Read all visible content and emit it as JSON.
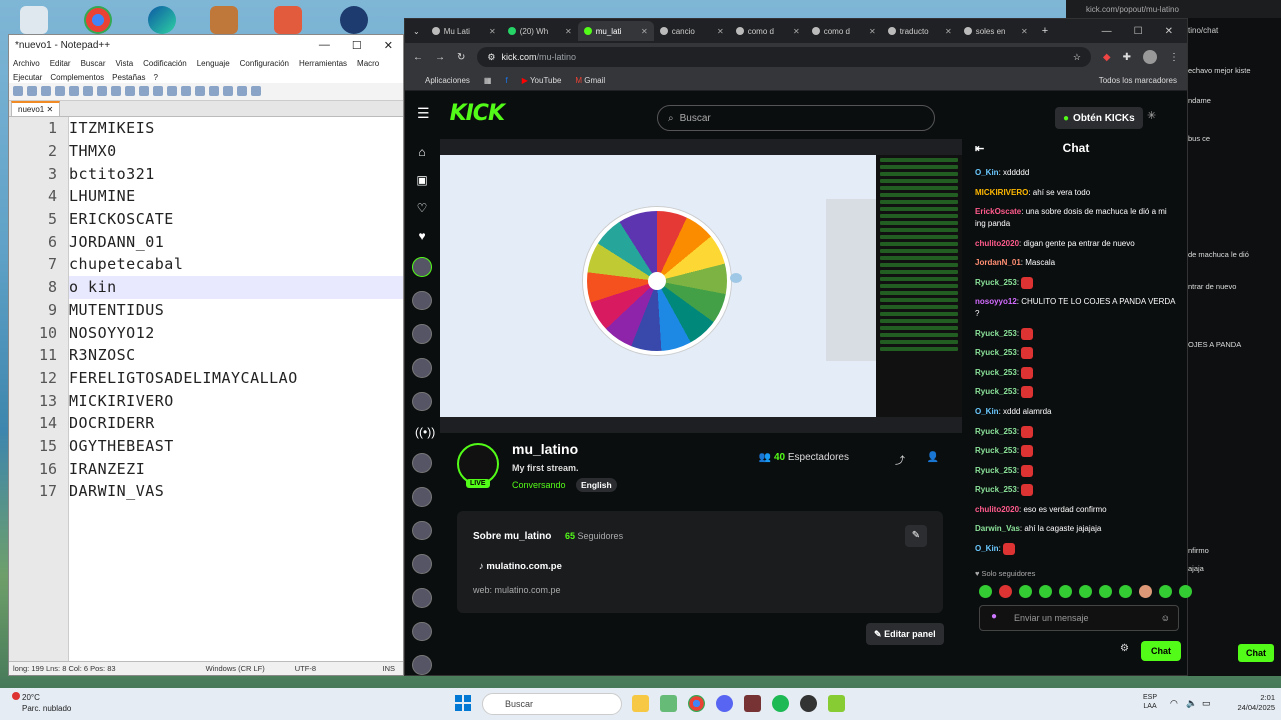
{
  "notepad": {
    "title": "*nuevo1 - Notepad++",
    "menu": [
      "Archivo",
      "Editar",
      "Buscar",
      "Vista",
      "Codificación",
      "Lenguaje",
      "Configuración",
      "Herramientas",
      "Macro"
    ],
    "menu2": [
      "Ejecutar",
      "Complementos",
      "Pestañas",
      "?"
    ],
    "tab": "nuevo1",
    "lines": [
      "ITZMIKEIS",
      "THMX0",
      "bctito321",
      "LHUMINE",
      "ERICKOSCATE",
      "JORDANN_01",
      "chupetecabal",
      "o kin",
      "MUTENTIDUS",
      "NOSOYYO12",
      "R3NZOSC",
      "FERELIGTOSADELIMAYCALLAO",
      "MICKIRIVERO",
      "DOCRIDERR",
      "OGYTHEBEAST",
      "IRANZEZI",
      "DARWIN_VAS"
    ],
    "active_line": 8,
    "status": [
      "long: 199 Lns: 8  Col: 6  Pos: 83",
      "Windows (CR LF)",
      "UTF-8",
      "INS"
    ]
  },
  "chrome": {
    "tabs": [
      "Mu Lati",
      "(20) Wh",
      "mu_lati",
      "cancio",
      "como d",
      "como d",
      "traducto",
      "soles en"
    ],
    "url_host": "kick.com",
    "url_path": "/mu-latino",
    "bookmarks": [
      "Aplicaciones",
      "YouTube",
      "Gmail"
    ],
    "bookmarks_right": "Todos los marcadores"
  },
  "kick": {
    "logo": "KICK",
    "search_placeholder": "Buscar",
    "kicks_button": "Obtén KICKs",
    "channel": "mu_latino",
    "stream_title": "My first stream.",
    "category": "Conversando",
    "language": "English",
    "live": "LIVE",
    "viewers_count": "40",
    "viewers_label": "Espectadores",
    "about_title": "Sobre mu_latino",
    "followers_count": "65",
    "followers_label": "Seguidores",
    "link": "mulatino.com.pe",
    "web": "web: mulatino.com.pe",
    "edit_panel": "Editar panel"
  },
  "chat": {
    "title": "Chat",
    "messages": [
      {
        "user": "O_Kin",
        "color": "#6ac9ff",
        "text": "xddddd"
      },
      {
        "user": "MICKIRIVERO",
        "color": "#ffb800",
        "text": "ahí se vera todo"
      },
      {
        "user": "ErickOscate",
        "color": "#ff5b8c",
        "text": "una sobre dosis de machuca le dió a mi ing panda"
      },
      {
        "user": "chulito2020",
        "color": "#ff5b8c",
        "text": "digan gente pa entrar de nuevo"
      },
      {
        "user": "JordanN_01",
        "color": "#ff8f73",
        "text": "Mascala"
      },
      {
        "user": "Ryuck_253",
        "color": "#8be39a",
        "text": ""
      },
      {
        "user": "nosoyyo12",
        "color": "#d36cff",
        "text": "CHULITO TE LO COJES A PANDA VERDA ?"
      },
      {
        "user": "Ryuck_253",
        "color": "#8be39a",
        "text": ""
      },
      {
        "user": "Ryuck_253",
        "color": "#8be39a",
        "text": ""
      },
      {
        "user": "Ryuck_253",
        "color": "#8be39a",
        "text": ""
      },
      {
        "user": "Ryuck_253",
        "color": "#8be39a",
        "text": ""
      },
      {
        "user": "O_Kin",
        "color": "#6ac9ff",
        "text": "xddd alamrda"
      },
      {
        "user": "Ryuck_253",
        "color": "#8be39a",
        "text": ""
      },
      {
        "user": "Ryuck_253",
        "color": "#8be39a",
        "text": ""
      },
      {
        "user": "Ryuck_253",
        "color": "#8be39a",
        "text": ""
      },
      {
        "user": "Ryuck_253",
        "color": "#8be39a",
        "text": ""
      },
      {
        "user": "chulito2020",
        "color": "#ff5b8c",
        "text": "eso es verdad confirmo"
      },
      {
        "user": "Darwin_Vas",
        "color": "#8be39a",
        "text": "ahí la cagaste jajajaja"
      },
      {
        "user": "O_Kin",
        "color": "#6ac9ff",
        "text": ""
      }
    ],
    "followers_only": "Solo seguidores",
    "input_placeholder": "Enviar un mensaje",
    "send": "Chat"
  },
  "popout": {
    "url": "kick.com/popout/mu-latino",
    "url_tail": "tino/chat",
    "lines": [
      "echavo mejor kiste",
      "ndame",
      "bus ce",
      "de machuca le dió",
      "ntrar de nuevo",
      "OJES A PANDA",
      "nfirmo",
      "ajaja"
    ],
    "send": "Chat"
  },
  "taskbar": {
    "temp": "20°C",
    "weather": "Parc. nublado",
    "search": "Buscar",
    "lang1": "ESP",
    "lang2": "LAA",
    "time": "2:01",
    "date": "24/04/2025"
  }
}
